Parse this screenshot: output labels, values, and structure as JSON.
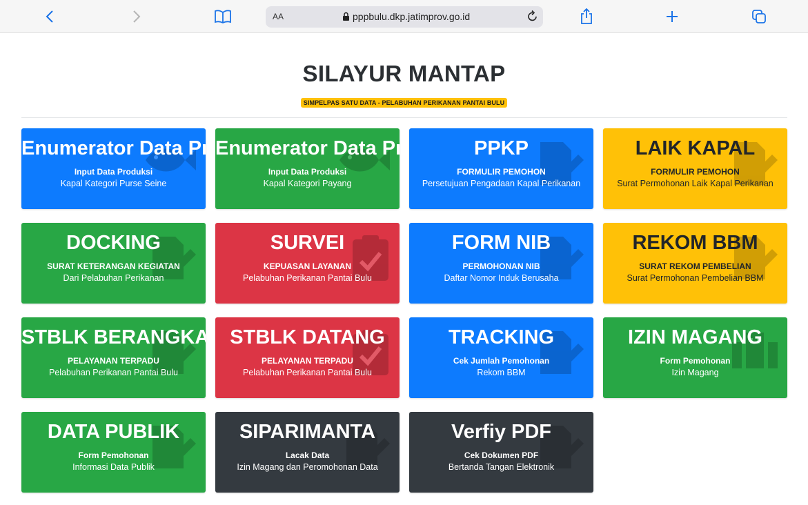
{
  "browser": {
    "text_size_label": "AA",
    "url": "pppbulu.dkp.jatimprov.go.id"
  },
  "header": {
    "title": "SILAYUR MANTAP",
    "subtitle": "SIMPELPAS SATU DATA - PELABUHAN PERIKANAN PANTAI BULU"
  },
  "colors": {
    "blue": "#0d7bfe",
    "green": "#28a745",
    "red": "#dc3545",
    "yellow": "#ffc107",
    "dark": "#343a40"
  },
  "cards": [
    {
      "title": "Enumerator Data Produksi",
      "label": "Input Data Produksi",
      "desc": "Kapal Kategori Purse Seine",
      "color": "blue",
      "icon": "fish-icon"
    },
    {
      "title": "Enumerator Data Produksi",
      "label": "Input Data Produksi",
      "desc": "Kapal Kategori Payang",
      "color": "green",
      "icon": "fish-icon"
    },
    {
      "title": "PPKP",
      "label": "FORMULIR PEMOHON",
      "desc": "Persetujuan Pengadaan Kapal Perikanan",
      "color": "blue",
      "icon": "file-signature-icon"
    },
    {
      "title": "LAIK KAPAL",
      "label": "FORMULIR PEMOHON",
      "desc": "Surat Permohonan Laik Kapal Perikanan",
      "color": "yellow",
      "icon": "file-signature-icon"
    },
    {
      "title": "DOCKING",
      "label": "SURAT KETERANGAN KEGIATAN",
      "desc": "Dari Pelabuhan Perikanan",
      "color": "green",
      "icon": "file-signature-icon"
    },
    {
      "title": "SURVEI",
      "label": "KEPUASAN LAYANAN",
      "desc": "Pelabuhan Perikanan Pantai Bulu",
      "color": "red",
      "icon": "clipboard-check-icon"
    },
    {
      "title": "FORM NIB",
      "label": "PERMOHONAN NIB",
      "desc": "Daftar Nomor Induk Berusaha",
      "color": "blue",
      "icon": "file-signature-icon"
    },
    {
      "title": "REKOM BBM",
      "label": "SURAT REKOM PEMBELIAN",
      "desc": "Surat Permohonan Pembelian BBM",
      "color": "yellow",
      "icon": "file-signature-icon"
    },
    {
      "title": "STBLK BERANGKAT",
      "label": "PELAYANAN TERPADU",
      "desc": "Pelabuhan Perikanan Pantai Bulu",
      "color": "green",
      "icon": "file-signature-icon"
    },
    {
      "title": "STBLK DATANG",
      "label": "PELAYANAN TERPADU",
      "desc": "Pelabuhan Perikanan Pantai Bulu",
      "color": "red",
      "icon": "clipboard-check-icon"
    },
    {
      "title": "TRACKING",
      "label": "Cek Jumlah Pemohonan",
      "desc": "Rekom BBM",
      "color": "blue",
      "icon": "file-signature-icon"
    },
    {
      "title": "IZIN MAGANG",
      "label": "Form Pemohonan",
      "desc": "Izin Magang",
      "color": "green",
      "icon": "building-icon"
    },
    {
      "title": "DATA PUBLIK",
      "label": "Form Pemohonan",
      "desc": "Informasi Data Publik",
      "color": "green",
      "icon": "file-signature-icon"
    },
    {
      "title": "SIPARIMANTA",
      "label": "Lacak Data",
      "desc": "Izin Magang dan Peromohonan Data",
      "color": "dark",
      "icon": "file-signature-icon"
    },
    {
      "title": "Verfiy PDF",
      "label": "Cek Dokumen PDF",
      "desc": "Bertanda Tangan Elektronik",
      "color": "dark",
      "icon": "file-signature-icon"
    }
  ]
}
